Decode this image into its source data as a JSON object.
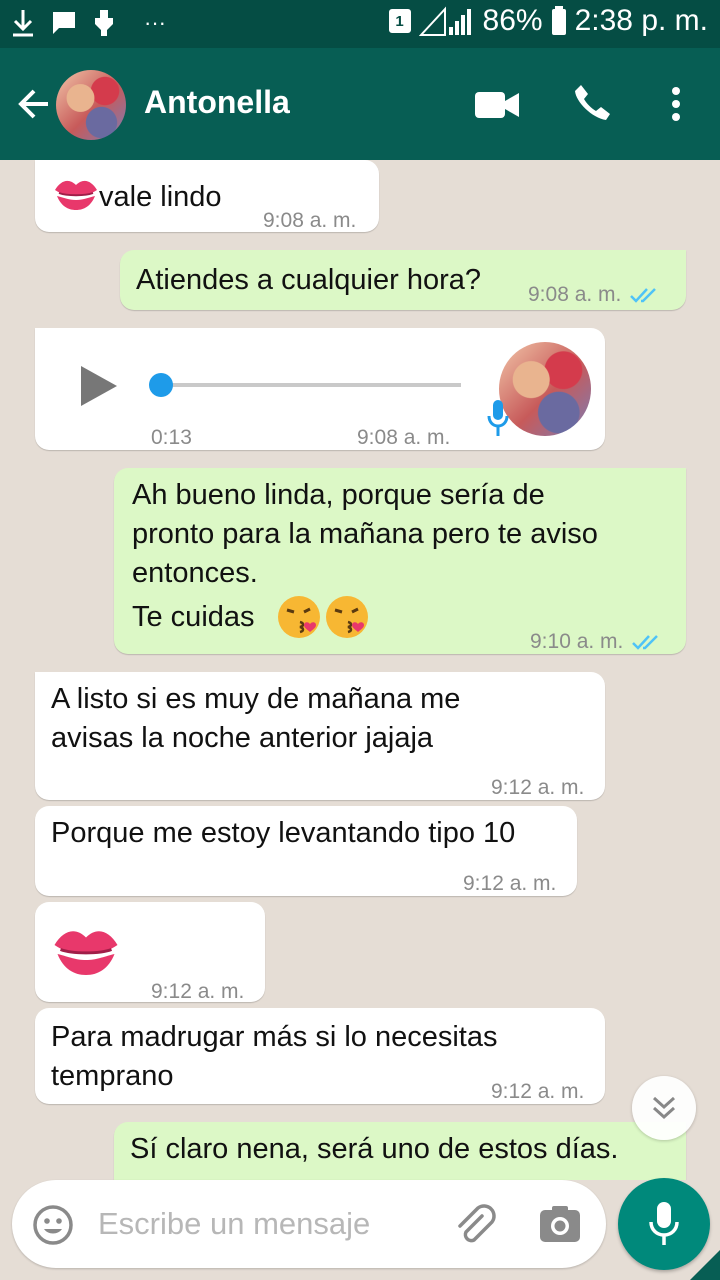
{
  "statusbar": {
    "sim": "1",
    "battery": "86%",
    "time": "2:38 p. m.",
    "dots": "···"
  },
  "header": {
    "contact_name": "Antonella",
    "icons": [
      "back-arrow-icon",
      "video-call-icon",
      "phone-icon",
      "more-vertical-icon"
    ]
  },
  "messages": [
    {
      "dir": "in",
      "text": "vale lindo",
      "time": "9:08 a. m.",
      "emoji": "kiss-mark"
    },
    {
      "dir": "out",
      "text": "Atiendes a cualquier hora?",
      "time": "9:08 a. m.",
      "read": true
    },
    {
      "dir": "in",
      "type": "voice",
      "duration": "0:13",
      "time": "9:08 a. m.",
      "progress": 0
    },
    {
      "dir": "out",
      "text": "Ah bueno linda, porque sería de\npronto para la mañana pero te aviso\nentonces.",
      "text2": "Te cuidas",
      "time": "9:10 a. m.",
      "read": true,
      "emoji": "face-blowing-kiss x2"
    },
    {
      "dir": "in",
      "text": "A listo si es muy de mañana me\navisas la noche anterior jajaja",
      "time": "9:12 a. m."
    },
    {
      "dir": "in",
      "text": "Porque me estoy levantando tipo 10",
      "time": "9:12 a. m."
    },
    {
      "dir": "in",
      "type": "emoji",
      "emoji": "kiss-mark",
      "time": "9:12 a. m."
    },
    {
      "dir": "in",
      "text": "Para madrugar más si lo necesitas\ntemprano",
      "time": "9:12 a. m."
    },
    {
      "dir": "out",
      "text": "Sí claro nena, será uno de estos días."
    }
  ],
  "input": {
    "placeholder": "Escribe un mensaje"
  },
  "colors": {
    "header": "#075e54",
    "statusbar": "#054d44",
    "outgoing": "#dcf8c6",
    "incoming": "#ffffff",
    "background": "#e5ddd5",
    "read_ticks": "#4fc3f7",
    "fab": "#00897b"
  }
}
